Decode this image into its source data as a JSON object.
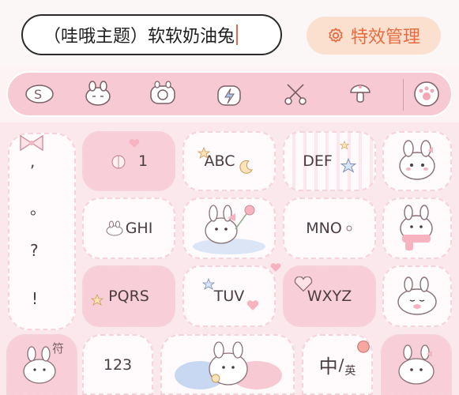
{
  "input": {
    "text": "（哇哦主题）软软奶油兔"
  },
  "effects_button": {
    "label": "特效管理",
    "icon": "gear-icon"
  },
  "toolbar": {
    "icons": [
      "swipe-s-icon",
      "bunny-face-icon",
      "camera-icon",
      "lightning-icon",
      "scissors-icon",
      "mushroom-icon",
      "paw-icon"
    ]
  },
  "keyboard": {
    "punct": [
      ",",
      "。",
      "?",
      "!"
    ],
    "keys": {
      "k1": "1",
      "abc": "ABC",
      "def": "DEF",
      "ghi": "GHI",
      "mno": "MNO",
      "pqrs": "PQRS",
      "tuv": "TUV",
      "wxyz": "WXYZ",
      "num": "123",
      "lang_main": "中",
      "lang_sub": "英",
      "symbol": "符"
    }
  },
  "colors": {
    "accent": "#e76b3f",
    "pink_key": "#f8cfd8",
    "white_key": "#fffafb",
    "toolbar": "#f7c9d2"
  }
}
